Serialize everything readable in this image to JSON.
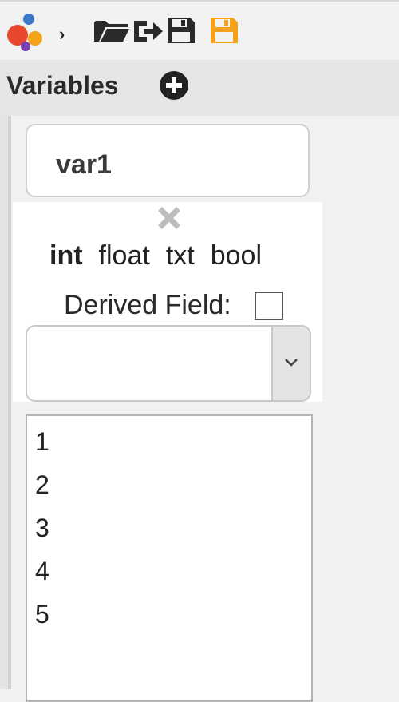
{
  "toolbar": {
    "breadcrumb_separator": "›",
    "icons": [
      "app-logo-icon",
      "open-folder-icon",
      "export-icon",
      "save-icon",
      "save-orange-icon"
    ],
    "accent_color": "#f5a21b"
  },
  "variables": {
    "heading": "Variables",
    "add_icon": "plus-circle-icon"
  },
  "variable": {
    "name": "var1",
    "delete_icon": "close-icon",
    "types": [
      "int",
      "float",
      "txt",
      "bool"
    ],
    "selected_type": "int",
    "derived_label": "Derived Field:",
    "derived_checked": false,
    "select_value": "",
    "values": [
      "1",
      "2",
      "3",
      "4",
      "5"
    ]
  }
}
